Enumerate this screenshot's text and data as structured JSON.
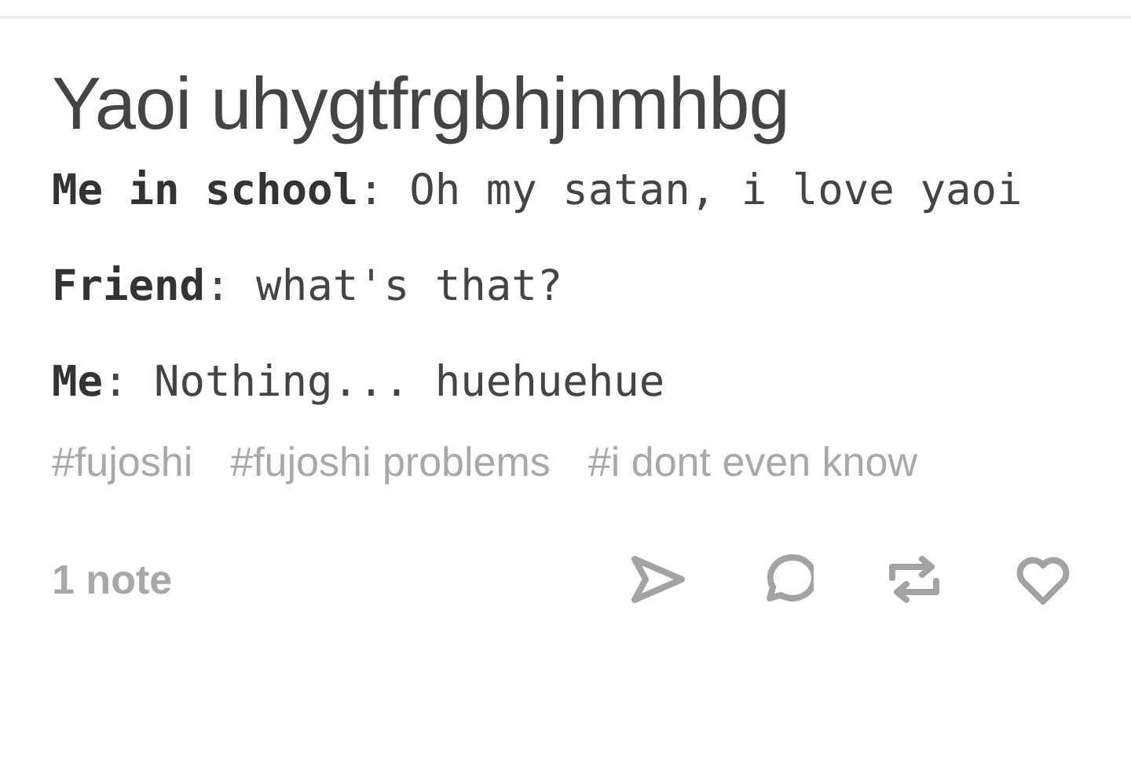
{
  "post": {
    "title": "Yaoi uhygtfrgbhjnmhbg",
    "lines": [
      "**Me in school**: Oh my satan, i love yaoi",
      "**Friend**: what's that?",
      "**Me**: Nothing... huehuehue"
    ],
    "tags": [
      "#fujoshi",
      "#fujoshi problems",
      "#i dont even know"
    ],
    "notes": "1 note"
  }
}
